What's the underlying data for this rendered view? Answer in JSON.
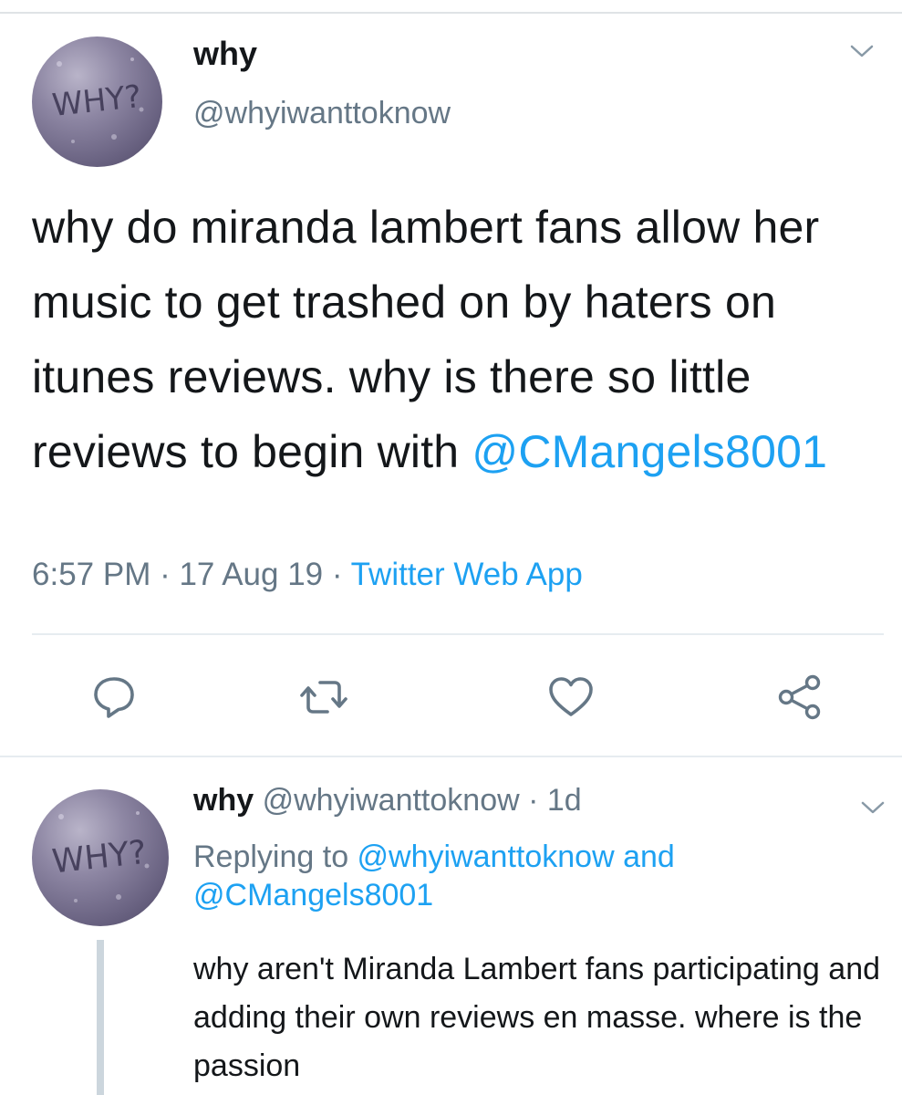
{
  "main_tweet": {
    "avatar_icon": "avatar-why-rain-glass",
    "avatar_text": "WHY?",
    "display_name": "why",
    "handle": "@whyiwanttoknow",
    "text_before_mention": "why do miranda lambert fans allow her music to get trashed on by haters on itunes reviews. why is there so little reviews to begin with ",
    "mention": "@CMangels8001",
    "time": "6:57 PM",
    "separator": " · ",
    "date": "17 Aug 19",
    "app": "Twitter Web App",
    "menu_icon": "chevron-down-icon"
  },
  "actions": [
    {
      "name": "reply",
      "icon": "reply-icon"
    },
    {
      "name": "retweet",
      "icon": "retweet-icon"
    },
    {
      "name": "like",
      "icon": "heart-icon"
    },
    {
      "name": "share",
      "icon": "share-icon"
    }
  ],
  "reply_tweet": {
    "avatar_text": "WHY?",
    "display_name": "why",
    "handle": "@whyiwanttoknow",
    "separator": " · ",
    "age": "1d",
    "replying_prefix": "Replying to ",
    "replying_mention_1": "@whyiwanttoknow",
    "replying_conjunction": " and",
    "replying_mention_2": "@CMangels8001",
    "text": "why aren't Miranda Lambert fans participating and adding their own reviews en masse. where is the passion",
    "menu_icon": "chevron-down-icon"
  },
  "colors": {
    "link": "#1da1f2",
    "secondary_text": "#657786",
    "primary_text": "#14171a",
    "icon": "#657786",
    "divider": "#e6ecf0"
  }
}
